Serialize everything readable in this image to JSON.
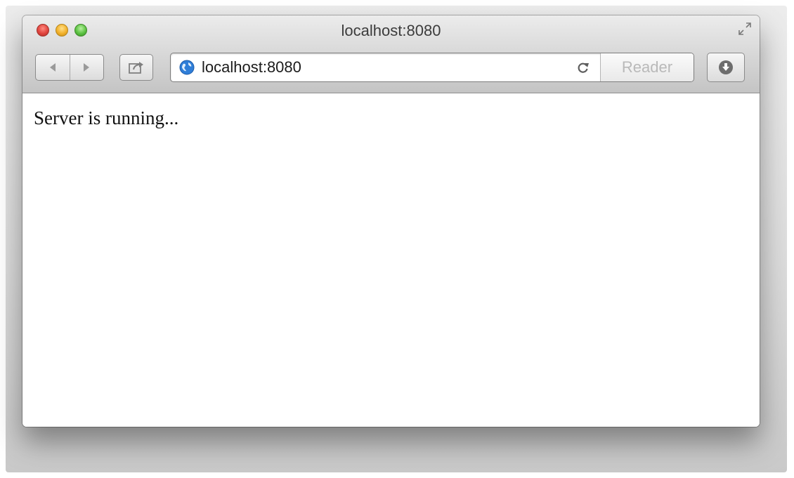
{
  "window": {
    "title": "localhost:8080"
  },
  "toolbar": {
    "url": "localhost:8080",
    "reader_label": "Reader",
    "icons": {
      "back": "back-arrow-icon",
      "forward": "forward-arrow-icon",
      "share": "share-icon",
      "globe": "globe-icon",
      "reload": "reload-icon",
      "download": "download-icon",
      "fullscreen": "fullscreen-icon"
    }
  },
  "content": {
    "text": "Server is running..."
  },
  "colors": {
    "close": "#e0443e",
    "minimize": "#f2b12b",
    "zoom": "#5cc242",
    "globe": "#2f7ed8"
  }
}
